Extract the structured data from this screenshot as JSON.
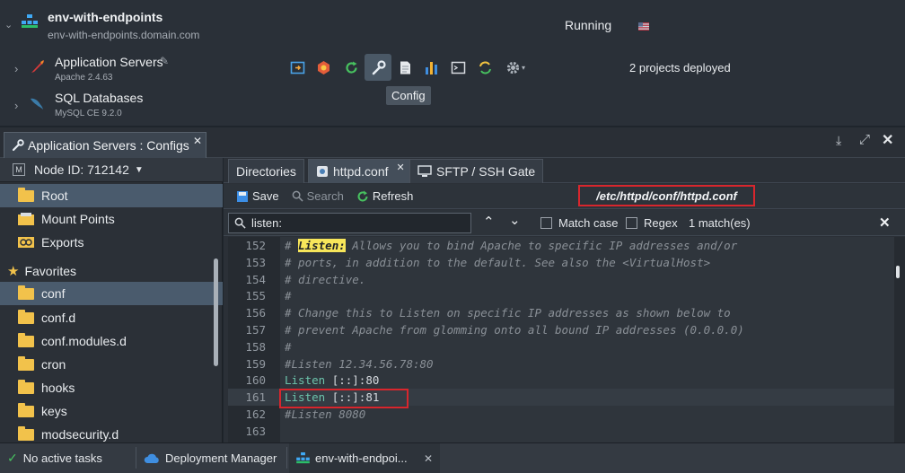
{
  "environment": {
    "name": "env-with-endpoints",
    "domain": "env-with-endpoints.domain.com",
    "status": "Running",
    "region_flag": "us-flag"
  },
  "nodes": [
    {
      "name": "Application Servers",
      "version": "Apache 2.4.63"
    },
    {
      "name": "SQL Databases",
      "version": "MySQL CE 9.2.0"
    }
  ],
  "node_toolbar": {
    "icons": [
      "open-in-browser-icon",
      "addons-icon",
      "restart-icon",
      "config-icon",
      "log-icon",
      "statistics-icon",
      "web-ssh-icon",
      "redeploy-icon",
      "settings-icon"
    ],
    "tooltip": "Config",
    "deployed_text": "2 projects deployed"
  },
  "config_window": {
    "tab_title": "Application Servers : Configs",
    "node_id": "Node ID: 712142",
    "tree": {
      "top_items": [
        "Root",
        "Mount Points",
        "Exports"
      ],
      "favorites_label": "Favorites",
      "favorites": [
        "conf",
        "conf.d",
        "conf.modules.d",
        "cron",
        "hooks",
        "keys",
        "modsecurity.d"
      ]
    },
    "tabs": [
      "Directories",
      "httpd.conf",
      "SFTP / SSH Gate"
    ],
    "toolbar": {
      "save": "Save",
      "search": "Search",
      "refresh": "Refresh"
    },
    "file_path": "/etc/httpd/conf/httpd.conf",
    "search": {
      "query": "listen:",
      "match_case": "Match case",
      "regex": "Regex",
      "matches": "1 match(es)"
    },
    "code": [
      {
        "n": "152",
        "parts": [
          [
            "cmt",
            "# "
          ],
          [
            "hl",
            "Listen:"
          ],
          [
            "cmt",
            " Allows you to bind Apache to specific IP addresses and/or"
          ]
        ]
      },
      {
        "n": "153",
        "parts": [
          [
            "cmt",
            "# ports, in addition to the default. See also the <VirtualHost>"
          ]
        ]
      },
      {
        "n": "154",
        "parts": [
          [
            "cmt",
            "# directive."
          ]
        ]
      },
      {
        "n": "155",
        "parts": [
          [
            "cmt",
            "#"
          ]
        ]
      },
      {
        "n": "156",
        "parts": [
          [
            "cmt",
            "# Change this to Listen on specific IP addresses as shown below to"
          ]
        ]
      },
      {
        "n": "157",
        "parts": [
          [
            "cmt",
            "# prevent Apache from glomming onto all bound IP addresses (0.0.0.0)"
          ]
        ]
      },
      {
        "n": "158",
        "parts": [
          [
            "cmt",
            "#"
          ]
        ]
      },
      {
        "n": "159",
        "parts": [
          [
            "cmt",
            "#Listen 12.34.56.78:80"
          ]
        ]
      },
      {
        "n": "160",
        "parts": [
          [
            "kw",
            "Listen "
          ],
          [
            "txt",
            "[::]:80"
          ]
        ]
      },
      {
        "n": "161",
        "parts": [
          [
            "kw",
            "Listen "
          ],
          [
            "txt",
            "[::]:81"
          ]
        ]
      },
      {
        "n": "162",
        "parts": [
          [
            "cmt",
            "#Listen 8080"
          ]
        ]
      },
      {
        "n": "163",
        "parts": []
      }
    ]
  },
  "bottom_bar": {
    "tasks": "No active tasks",
    "deployment_manager": "Deployment Manager",
    "env_tab": "env-with-endpoi..."
  },
  "colors": {
    "accent_highlight": "#d8262d",
    "folder": "#f2c24b",
    "keyword": "#6cc3ab"
  }
}
